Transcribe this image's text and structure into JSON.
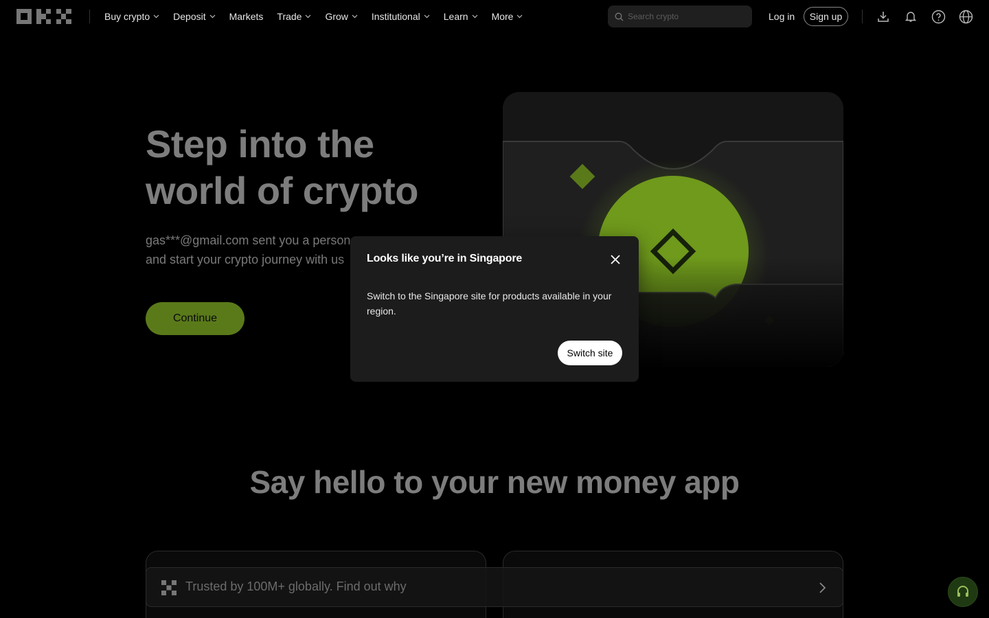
{
  "nav": {
    "logo_name": "OKX",
    "items": [
      {
        "label": "Buy crypto",
        "has_dropdown": true
      },
      {
        "label": "Deposit",
        "has_dropdown": true
      },
      {
        "label": "Markets",
        "has_dropdown": false
      },
      {
        "label": "Trade",
        "has_dropdown": true
      },
      {
        "label": "Grow",
        "has_dropdown": true
      },
      {
        "label": "Institutional",
        "has_dropdown": true
      },
      {
        "label": "Learn",
        "has_dropdown": true
      },
      {
        "label": "More",
        "has_dropdown": true
      }
    ],
    "search_placeholder": "Search crypto",
    "login_label": "Log in",
    "signup_label": "Sign up",
    "icons": [
      "download-icon",
      "bell-icon",
      "help-icon",
      "globe-icon"
    ]
  },
  "hero": {
    "title_line1": "Step into the",
    "title_line2": "world of crypto",
    "subtitle_line1": "gas***@gmail.com sent you a person",
    "subtitle_line2": "and start your crypto journey with us",
    "continue_label": "Continue"
  },
  "section": {
    "title": "Say hello to your new money app"
  },
  "banner": {
    "text": "Trusted by 100M+ globally. Find out why"
  },
  "modal": {
    "title": "Looks like you’re in Singapore",
    "body": "Switch to the Singapore site for products available in your region.",
    "button_label": "Switch site"
  },
  "colors": {
    "background": "#000000",
    "accent_green": "#5a7a1a",
    "modal_bg": "#1c1c1c",
    "dim_text": "#7d7d7d"
  }
}
